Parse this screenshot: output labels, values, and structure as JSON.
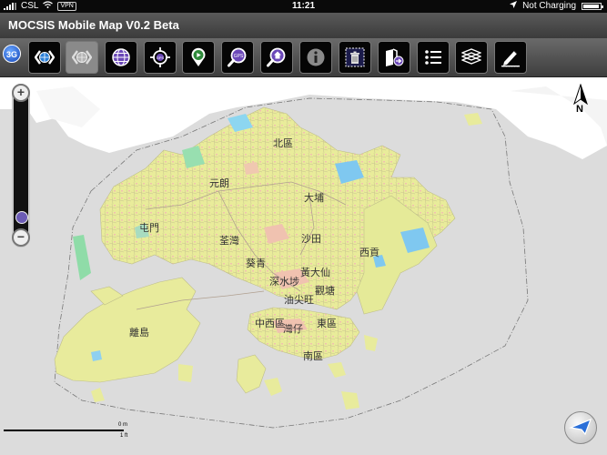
{
  "status_bar": {
    "carrier": "CSL",
    "vpn": "VPN",
    "time": "11:21",
    "charging": "Not Charging"
  },
  "app": {
    "title": "MOCSIS Mobile Map V0.2 Beta"
  },
  "badge": {
    "label": "3G"
  },
  "toolbar": {
    "buttons": [
      {
        "icon": "globe-back-forward-icon"
      },
      {
        "icon": "globe-back-forward-pressed-icon"
      },
      {
        "icon": "globe-icon"
      },
      {
        "icon": "gps-target-icon"
      },
      {
        "icon": "play-location-icon"
      },
      {
        "icon": "gps-search-icon"
      },
      {
        "icon": "home-search-icon"
      },
      {
        "icon": "info-icon"
      },
      {
        "icon": "trash-icon"
      },
      {
        "icon": "book-forward-icon"
      },
      {
        "icon": "list-icon"
      },
      {
        "icon": "layers-icon"
      },
      {
        "icon": "pencil-icon"
      }
    ]
  },
  "map": {
    "zoom_in": "+",
    "zoom_out": "−",
    "north_label": "N",
    "scale_top": "0 m",
    "scale_bottom": "1 ft",
    "place_labels": [
      {
        "id": "north",
        "text": "北區"
      },
      {
        "id": "yuen-long",
        "text": "元朗"
      },
      {
        "id": "tai-po",
        "text": "大埔"
      },
      {
        "id": "tuen-mun",
        "text": "屯門"
      },
      {
        "id": "tsuen-wan",
        "text": "荃灣"
      },
      {
        "id": "sha-tin",
        "text": "沙田"
      },
      {
        "id": "sai-kung",
        "text": "西貢"
      },
      {
        "id": "kwai-tsing",
        "text": "葵青"
      },
      {
        "id": "wong-tai-sin",
        "text": "黃大仙"
      },
      {
        "id": "sham-shui-po",
        "text": "深水埗"
      },
      {
        "id": "kwun-tong",
        "text": "觀塘"
      },
      {
        "id": "yau-tsim-mong",
        "text": "油尖旺"
      },
      {
        "id": "islands",
        "text": "離島"
      },
      {
        "id": "central-western",
        "text": "中西區"
      },
      {
        "id": "wan-chai",
        "text": "灣仔"
      },
      {
        "id": "eastern",
        "text": "東區"
      },
      {
        "id": "southern",
        "text": "南區"
      }
    ]
  }
}
